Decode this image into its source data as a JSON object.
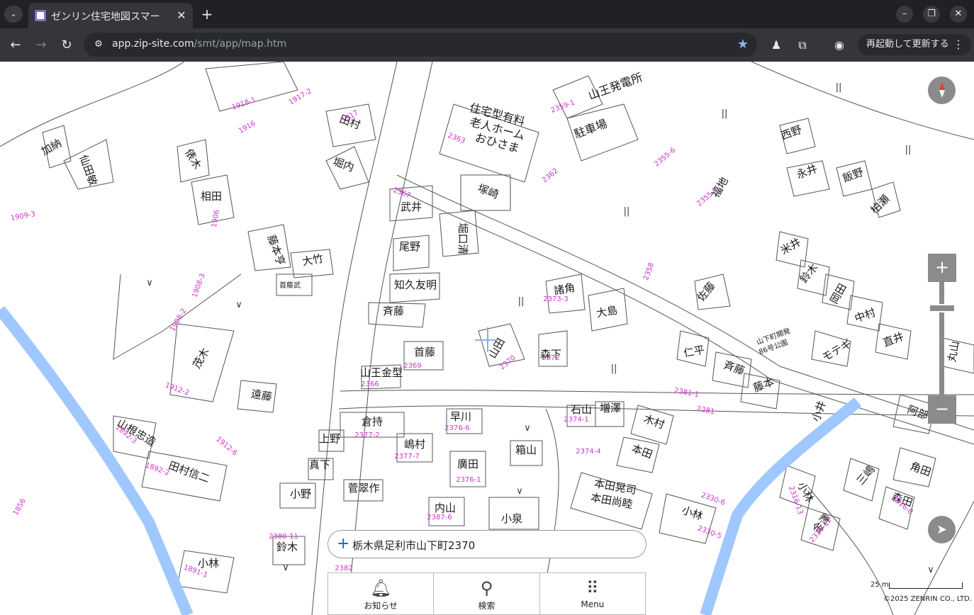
{
  "browser": {
    "tab_title": "ゼンリン住宅地図スマー",
    "tab_close": "✕",
    "new_tab": "+",
    "url_host": "app.zip-site.com",
    "url_path": "/smt/app/map.htm",
    "relaunch_label": "再起動して更新する",
    "window": {
      "minimize": "–",
      "restore": "❐",
      "close": "✕"
    }
  },
  "map": {
    "labels": [
      {
        "text": "山王発電所",
        "type": "building"
      },
      {
        "text": "住宅型有料",
        "type": "building"
      },
      {
        "text": "老人ホーム",
        "type": "building"
      },
      {
        "text": "おひさま",
        "type": "building"
      },
      {
        "text": "駐車場",
        "type": "building"
      },
      {
        "text": "西野",
        "type": "house"
      },
      {
        "text": "福地",
        "type": "house"
      },
      {
        "text": "永井",
        "type": "house"
      },
      {
        "text": "飯野",
        "type": "house"
      },
      {
        "text": "柏瀬",
        "type": "house"
      },
      {
        "text": "田村",
        "type": "house"
      },
      {
        "text": "堀内",
        "type": "house"
      },
      {
        "text": "加納",
        "type": "house"
      },
      {
        "text": "仙田敏",
        "type": "house"
      },
      {
        "text": "俵木",
        "type": "house"
      },
      {
        "text": "相田",
        "type": "house"
      },
      {
        "text": "武井",
        "type": "house"
      },
      {
        "text": "塚崎",
        "type": "house"
      },
      {
        "text": "堀口清",
        "type": "house"
      },
      {
        "text": "尾野",
        "type": "house"
      },
      {
        "text": "知久友明",
        "type": "house"
      },
      {
        "text": "斉藤",
        "type": "house"
      },
      {
        "text": "首藤",
        "type": "house"
      },
      {
        "text": "山王金型",
        "type": "house"
      },
      {
        "text": "山田",
        "type": "house"
      },
      {
        "text": "森下",
        "type": "house"
      },
      {
        "text": "諸角",
        "type": "house"
      },
      {
        "text": "大島",
        "type": "house"
      },
      {
        "text": "仁平",
        "type": "house"
      },
      {
        "text": "斉藤",
        "type": "house"
      },
      {
        "text": "藤本",
        "type": "house"
      },
      {
        "text": "佐藤",
        "type": "house"
      },
      {
        "text": "米井",
        "type": "house"
      },
      {
        "text": "鈴木",
        "type": "house"
      },
      {
        "text": "岡田",
        "type": "house"
      },
      {
        "text": "中村",
        "type": "house"
      },
      {
        "text": "直井",
        "type": "house"
      },
      {
        "text": "モテギ",
        "type": "house"
      },
      {
        "text": "山下町開発",
        "type": "small"
      },
      {
        "text": "86号公園",
        "type": "small"
      },
      {
        "text": "大竹",
        "type": "house"
      },
      {
        "text": "藤本亨",
        "type": "house"
      },
      {
        "text": "首藤武",
        "type": "small"
      },
      {
        "text": "茂木",
        "type": "house"
      },
      {
        "text": "遠藤",
        "type": "house"
      },
      {
        "text": "山根忠造",
        "type": "house"
      },
      {
        "text": "田村信二",
        "type": "house"
      },
      {
        "text": "小林",
        "type": "house"
      },
      {
        "text": "倉持",
        "type": "house"
      },
      {
        "text": "早川",
        "type": "house"
      },
      {
        "text": "上野",
        "type": "house"
      },
      {
        "text": "嶋村",
        "type": "house"
      },
      {
        "text": "箱山",
        "type": "house"
      },
      {
        "text": "真下",
        "type": "house"
      },
      {
        "text": "廣田",
        "type": "house"
      },
      {
        "text": "小野",
        "type": "house"
      },
      {
        "text": "菅翠作",
        "type": "house"
      },
      {
        "text": "内山",
        "type": "house"
      },
      {
        "text": "小泉",
        "type": "house"
      },
      {
        "text": "鈴木",
        "type": "house"
      },
      {
        "text": "石山",
        "type": "house"
      },
      {
        "text": "増澤",
        "type": "house"
      },
      {
        "text": "木村",
        "type": "house"
      },
      {
        "text": "本田",
        "type": "house"
      },
      {
        "text": "本田晃司",
        "type": "house"
      },
      {
        "text": "本田尚睦",
        "type": "house"
      },
      {
        "text": "小林",
        "type": "house"
      },
      {
        "text": "阿部",
        "type": "house"
      },
      {
        "text": "角田",
        "type": "house"
      },
      {
        "text": "森田",
        "type": "house"
      },
      {
        "text": "小林",
        "type": "house"
      },
      {
        "text": "金澤",
        "type": "house"
      },
      {
        "text": "三嶋",
        "type": "house"
      },
      {
        "text": "丸山",
        "type": "house"
      },
      {
        "text": "小井",
        "type": "house"
      }
    ],
    "lot_numbers": [
      "1918-1",
      "1917-2",
      "1916",
      "1917",
      "1908-3",
      "1909-3",
      "1906",
      "1908-2",
      "1912-2",
      "1892-2",
      "1891-1",
      "1892-3",
      "1912-6",
      "1856",
      "2363",
      "2362",
      "2367",
      "2369",
      "2366",
      "2370",
      "2372",
      "2373-3",
      "2355-6",
      "2355-7",
      "2358",
      "2359-1",
      "2381-1",
      "2381",
      "2377-2",
      "2376-6",
      "2377-7",
      "2376-1",
      "2387-6",
      "2374-1",
      "2374-4",
      "2330-6",
      "2330-5",
      "2316-13",
      "2316-12",
      "2316-8",
      "2380-11",
      "2382"
    ],
    "symbols": [
      "||",
      "||",
      "||",
      "||",
      "||",
      "||",
      "∨",
      "∨",
      "∨",
      "∨",
      "∨",
      "∨"
    ],
    "scale_label": "25 m",
    "copyright": "©2025 ZENRIN CO., LTD."
  },
  "address": {
    "text": "栃木県足利市山下町2370"
  },
  "bottom_nav": [
    {
      "label": "お知らせ",
      "icon": "bell-icon"
    },
    {
      "label": "検索",
      "icon": "search-icon"
    },
    {
      "label": "Menu",
      "icon": "menu-grid-icon"
    }
  ],
  "colors": {
    "river": "#9ec8ff",
    "lot_number": "#d033d0",
    "outline": "#444444",
    "control": "#8b8b8b"
  }
}
